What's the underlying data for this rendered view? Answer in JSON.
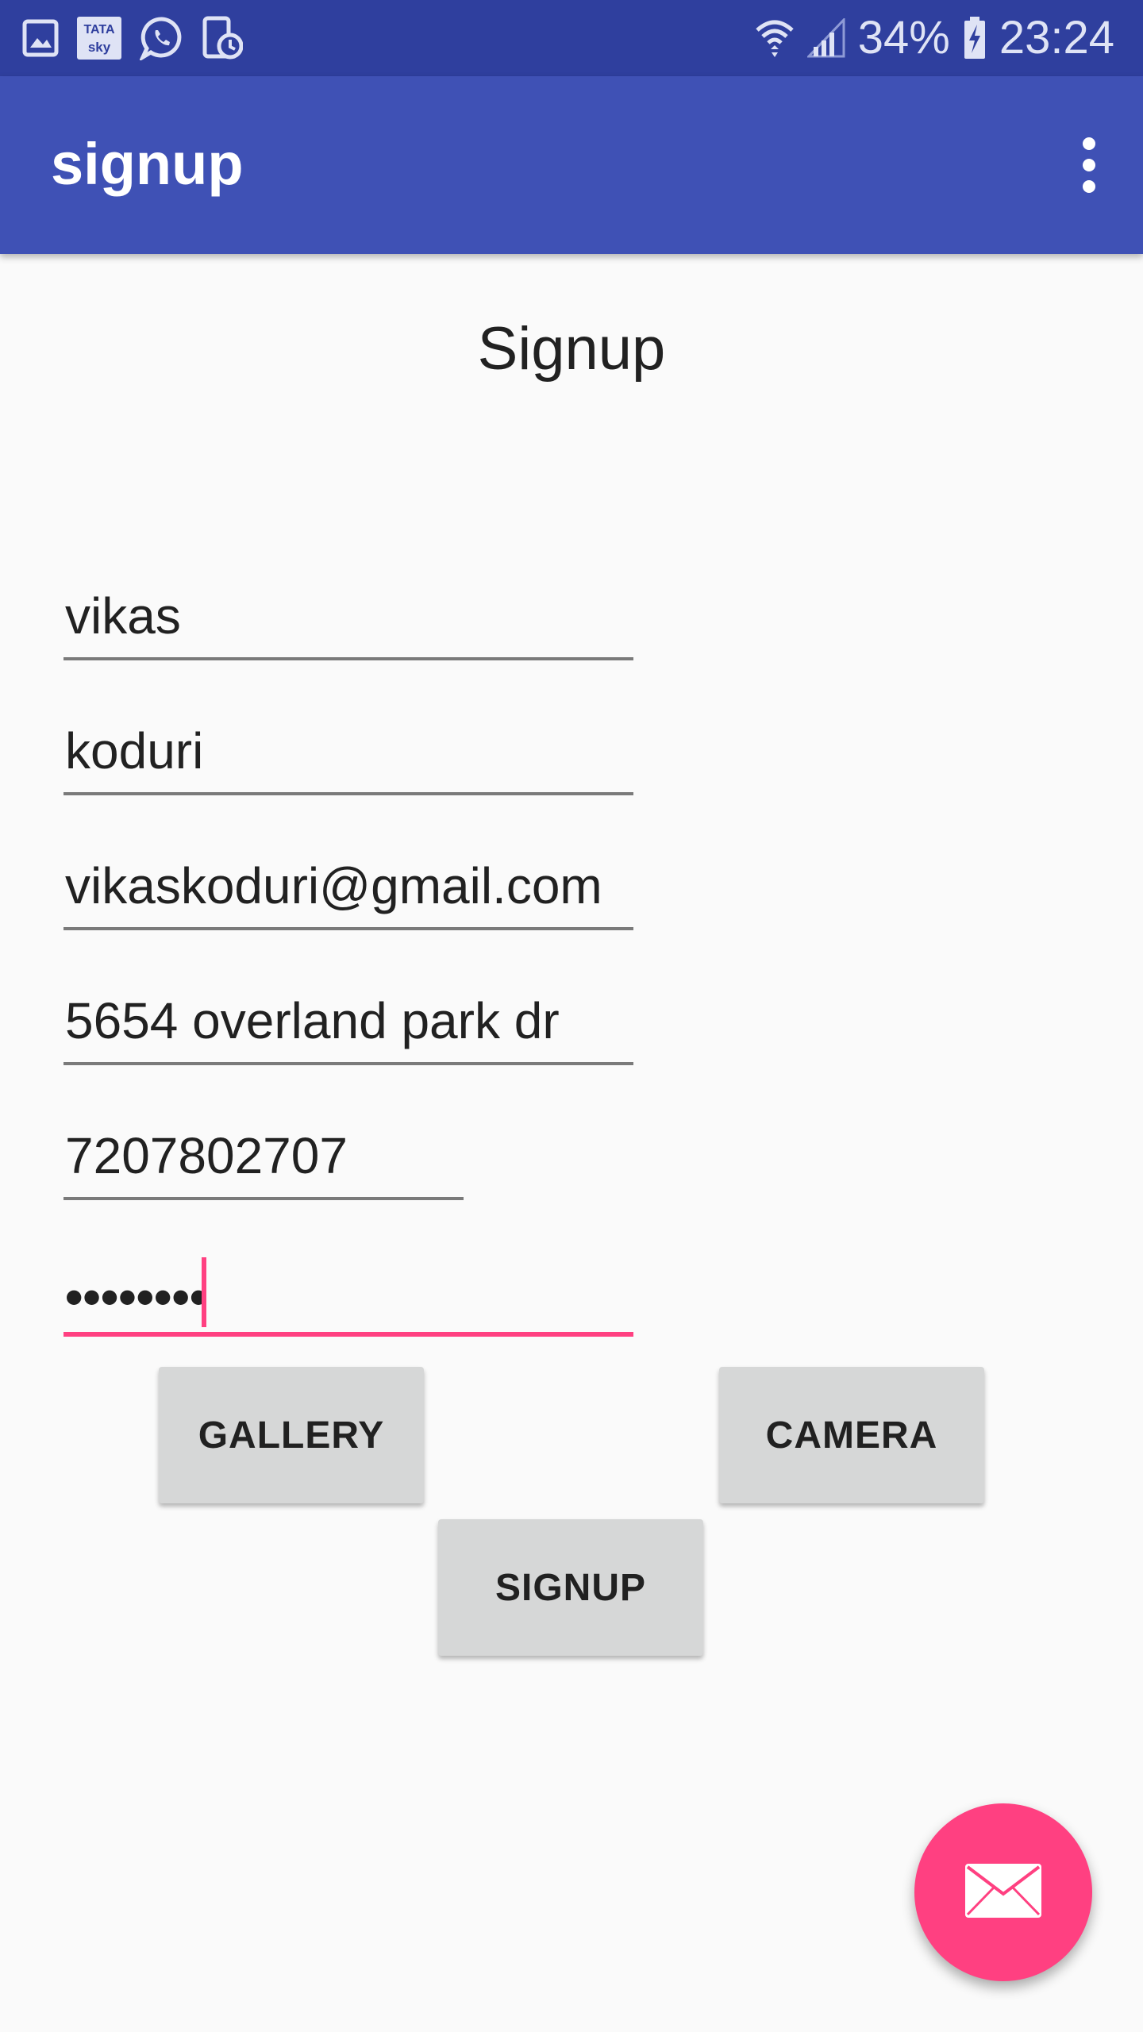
{
  "status_bar": {
    "left_icons": [
      "gallery-icon",
      "tata-sky-icon",
      "whatsapp-icon",
      "phone-sync-icon"
    ],
    "tata_sky_label_top": "TATA",
    "tata_sky_label_bottom": "sky",
    "right_icons": [
      "wifi-icon",
      "signal-icon",
      "battery-charging-icon"
    ],
    "battery": "34%",
    "time": "23:24"
  },
  "app_bar": {
    "title": "signup",
    "menu_icon": "more-vert-icon"
  },
  "form": {
    "heading": "Signup",
    "fields": [
      {
        "name": "first-name",
        "value": "vikas"
      },
      {
        "name": "last-name",
        "value": "koduri"
      },
      {
        "name": "email",
        "value": "vikaskoduri@gmail.com"
      },
      {
        "name": "address",
        "value": "5654 overland park dr"
      },
      {
        "name": "phone",
        "value": "7207802707"
      },
      {
        "name": "password",
        "value": "••••••••"
      }
    ],
    "focused_field": "password"
  },
  "buttons": {
    "gallery": "GALLERY",
    "camera": "CAMERA",
    "signup": "SIGNUP"
  },
  "fab": {
    "icon": "email-icon"
  },
  "colors": {
    "status_bar": "#2f3f9e",
    "app_bar": "#3f51b5",
    "accent": "#ff4081",
    "background": "#fafafa",
    "button": "#d6d7d7"
  }
}
